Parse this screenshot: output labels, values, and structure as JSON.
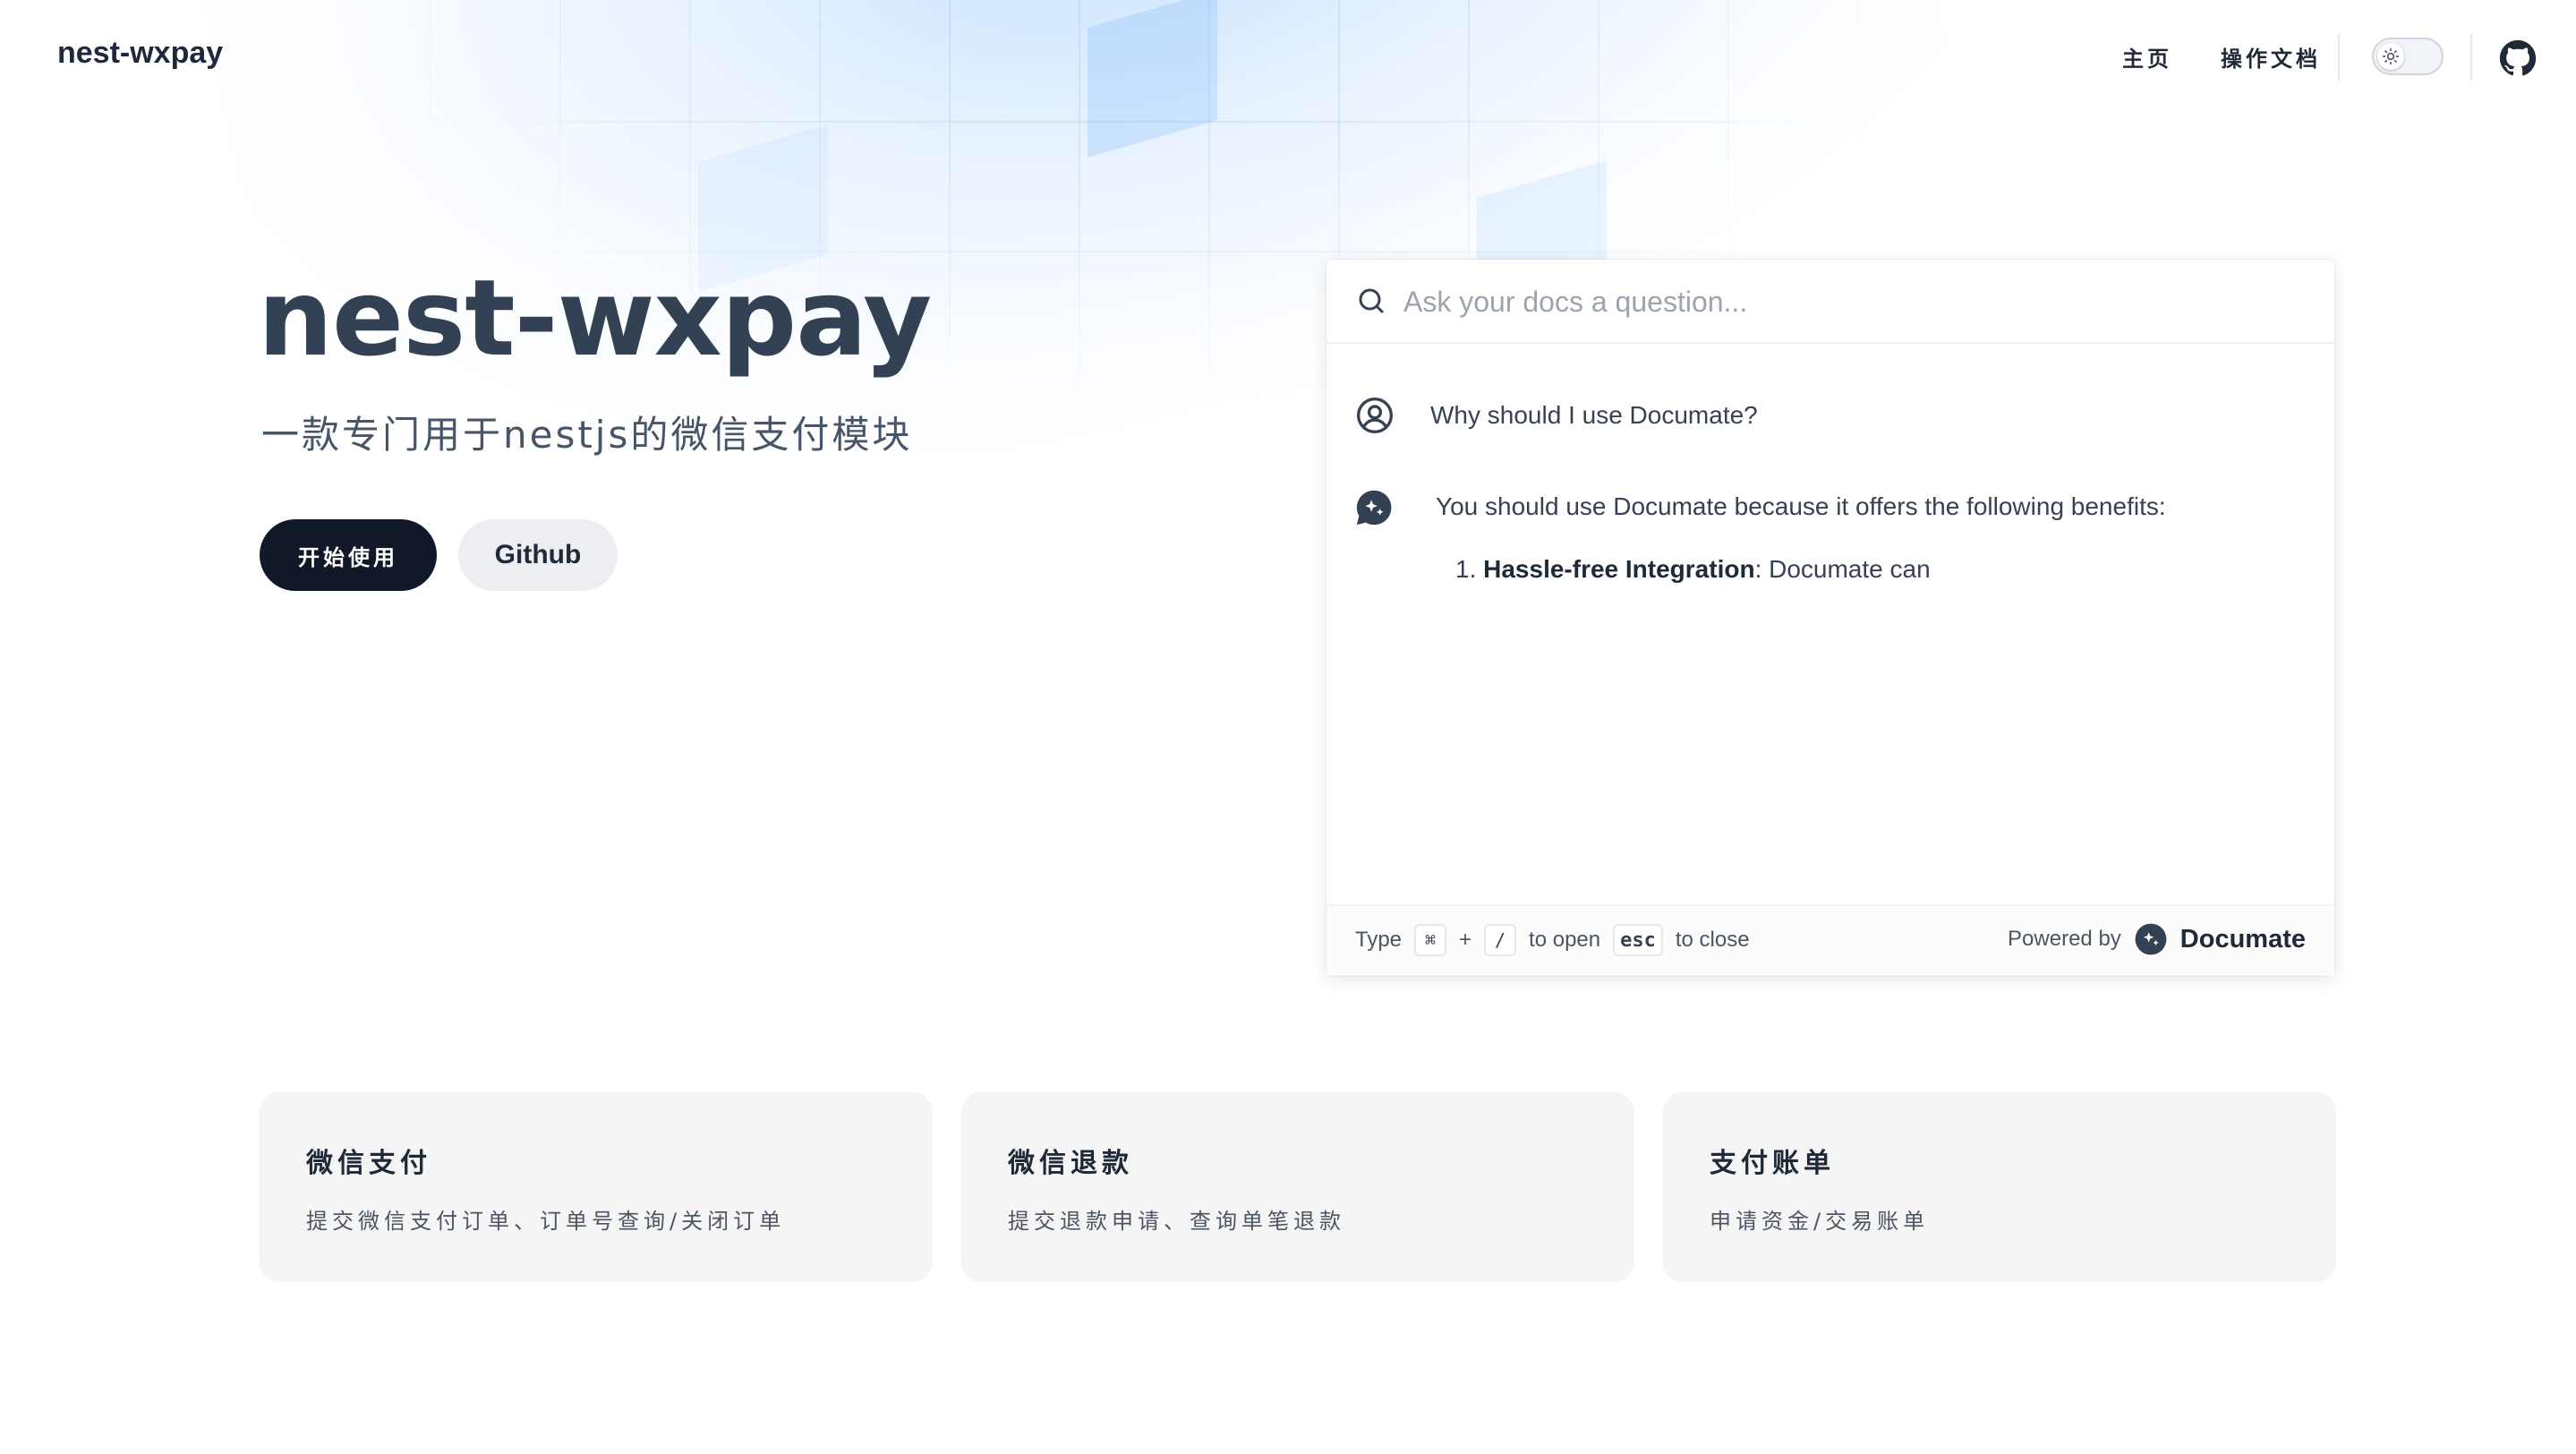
{
  "nav": {
    "brand": "nest-wxpay",
    "links": [
      {
        "label": "主页"
      },
      {
        "label": "操作文档"
      }
    ],
    "theme_toggle": "light",
    "github_icon": "github-icon"
  },
  "hero": {
    "title": "nest-wxpay",
    "subtitle": "一款专门用于nestjs的微信支付模块",
    "primary_button": "开始使用",
    "secondary_button": "Github"
  },
  "ask_panel": {
    "search_placeholder": "Ask your docs a question...",
    "question": "Why should I use Documate?",
    "answer_intro": "You should use Documate because it offers the following benefits:",
    "answer_item_number": "1.",
    "answer_item_bold": "Hassle-free Integration",
    "answer_item_rest": ": Documate can",
    "footer": {
      "type_label": "Type",
      "key_cmd": "⌘",
      "plus": "+",
      "key_slash": "/",
      "to_open": "to open",
      "key_esc": "esc",
      "to_close": "to close",
      "powered_by": "Powered by",
      "brand": "Documate"
    }
  },
  "features": [
    {
      "title": "微信支付",
      "description": "提交微信支付订单、订单号查询/关闭订单"
    },
    {
      "title": "微信退款",
      "description": "提交退款申请、查询单笔退款"
    },
    {
      "title": "支付账单",
      "description": "申请资金/交易账单"
    }
  ],
  "colors": {
    "primary_button_bg": "#111827",
    "secondary_button_bg": "#eceef2",
    "card_bg": "#f5f5f5",
    "grid_tint": "#93c5fd"
  }
}
